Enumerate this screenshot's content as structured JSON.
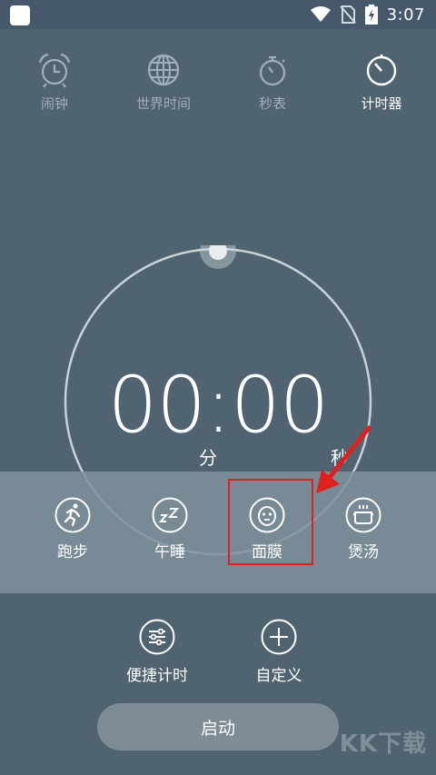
{
  "status_bar": {
    "time": "3:07"
  },
  "tabs": [
    {
      "label": "闹钟",
      "icon": "alarm-clock-icon"
    },
    {
      "label": "世界时间",
      "icon": "globe-icon"
    },
    {
      "label": "秒表",
      "icon": "stopwatch-icon"
    },
    {
      "label": "计时器",
      "icon": "timer-icon",
      "active": true
    }
  ],
  "timer": {
    "display": "00:00",
    "minutes_unit": "分",
    "seconds_unit": "秒"
  },
  "presets": [
    {
      "label": "跑步",
      "icon": "running-icon"
    },
    {
      "label": "午睡",
      "icon": "sleep-zz-icon"
    },
    {
      "label": "面膜",
      "icon": "face-mask-icon"
    },
    {
      "label": "煲汤",
      "icon": "soup-pot-icon"
    }
  ],
  "actions": {
    "quick_timer": "便捷计时",
    "custom": "自定义"
  },
  "start_button": "启动",
  "watermark": "KK下载",
  "colors": {
    "background": "#4f6470",
    "accent_red": "#e0201e",
    "inactive_label": "#9fb0ba"
  }
}
